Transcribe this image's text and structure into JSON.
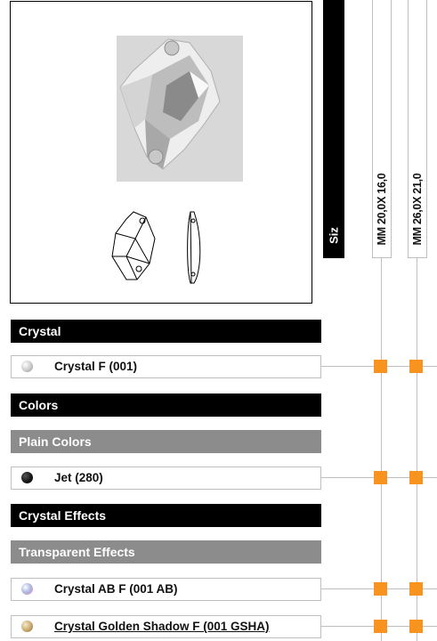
{
  "header": {
    "column_title": "Siz",
    "sizes": [
      "MM 20,0X 16,0",
      "MM 26,0X 21,0"
    ]
  },
  "sections": [
    {
      "type": "category",
      "label": "Crystal"
    },
    {
      "type": "item",
      "label": "Crystal F (001)",
      "swatch": "#c9c9c9",
      "available": [
        true,
        true
      ]
    },
    {
      "type": "category",
      "label": "Colors"
    },
    {
      "type": "subcategory",
      "label": "Plain Colors"
    },
    {
      "type": "item",
      "label": "Jet (280)",
      "swatch": "#111111",
      "available": [
        true,
        true
      ]
    },
    {
      "type": "category",
      "label": "Crystal Effects"
    },
    {
      "type": "subcategory",
      "label": "Transparent Effects"
    },
    {
      "type": "item",
      "label": "Crystal AB F (001 AB)",
      "swatch": "#a9b7e0",
      "available": [
        true,
        true
      ]
    },
    {
      "type": "item",
      "label": "Crystal Golden Shadow F (001 GSHA)",
      "swatch": "#c9a86a",
      "available": [
        true,
        true
      ],
      "link": true
    }
  ],
  "colors": {
    "availability_dot": "#f7931e",
    "category_bar": "#000000",
    "subcategory_bar": "#8c8c8c"
  },
  "icons": {
    "product_photo": "cosmic-crystal-photo",
    "technical_drawing": "cosmic-outline-drawing"
  }
}
